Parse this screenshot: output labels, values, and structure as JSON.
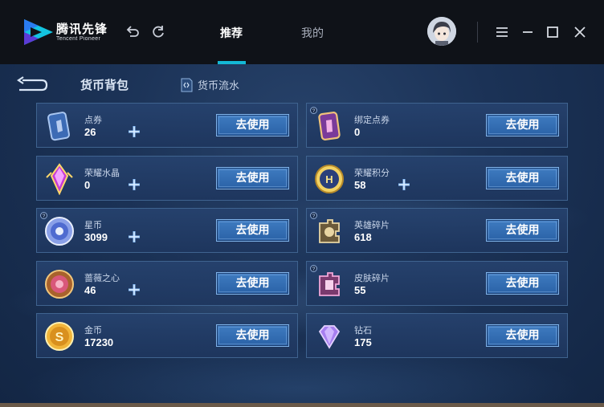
{
  "app": {
    "brand_cn": "腾讯先锋",
    "brand_en": "Tencent Pioneer",
    "accent": "#14b8d6"
  },
  "tabs": [
    {
      "label": "推荐",
      "active": true
    },
    {
      "label": "我的",
      "active": false
    }
  ],
  "page": {
    "title": "货币背包",
    "flow_link": "货币流水"
  },
  "button_label": "去使用",
  "currencies": [
    {
      "name": "点券",
      "value": "26",
      "icon": "coupon-icon",
      "has_plus": true,
      "info": false
    },
    {
      "name": "绑定点券",
      "value": "0",
      "icon": "bound-coupon-icon",
      "has_plus": false,
      "info": true
    },
    {
      "name": "荣耀水晶",
      "value": "0",
      "icon": "crystal-icon",
      "has_plus": true,
      "info": false
    },
    {
      "name": "荣耀积分",
      "value": "58",
      "icon": "honor-points-icon",
      "has_plus": true,
      "info": false
    },
    {
      "name": "星币",
      "value": "3099",
      "icon": "star-coin-icon",
      "has_plus": true,
      "info": true
    },
    {
      "name": "英雄碎片",
      "value": "618",
      "icon": "hero-fragment-icon",
      "has_plus": false,
      "info": true
    },
    {
      "name": "蔷薇之心",
      "value": "46",
      "icon": "rose-heart-icon",
      "has_plus": true,
      "info": false
    },
    {
      "name": "皮肤碎片",
      "value": "55",
      "icon": "skin-fragment-icon",
      "has_plus": false,
      "info": true
    },
    {
      "name": "金币",
      "value": "17230",
      "icon": "gold-coin-icon",
      "has_plus": false,
      "info": false
    },
    {
      "name": "钻石",
      "value": "175",
      "icon": "diamond-icon",
      "has_plus": false,
      "info": false
    }
  ]
}
